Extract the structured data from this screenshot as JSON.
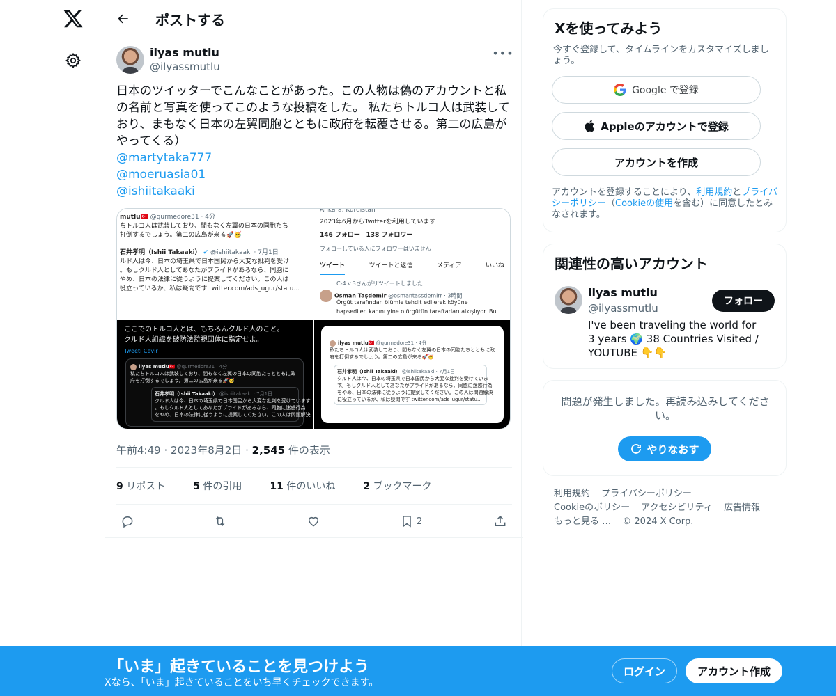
{
  "header": {
    "title": "ポストする"
  },
  "tweet": {
    "author_name": "ilyas mutlu",
    "author_handle": "@ilyassmutlu",
    "more_label": "•••",
    "text": "日本のツイッターでこんなことがあった。この人物は偽のアカウントと私の名前と写真を使ってこのような投稿をした。 私たちトルコ人は武装しており、まもなく日本の左翼同胞とともに政府を転覆させる。第二の広島がやってくる）",
    "mentions": [
      "@martytaka777",
      "@moeruasia01",
      "@ishiitakaaki"
    ],
    "time": "午前4:49",
    "date": "2023年8月2日",
    "views_count": "2,545",
    "views_label": " 件の表示",
    "sep": "·"
  },
  "media": {
    "img1": {
      "line1_name": "mutlu🇹🇷",
      "line1_handle": " @qurmedore31 · 4分",
      "line2": "ちトルコ人は武装しており、間もなく左翼の日本の同胞たち",
      "line3": "打倒するでしょう。第二の広島が来る🚀🥳",
      "line4_name": "石井孝明（Ishii Takaaki）",
      "line4_handle": " @ishiitakaaki · 7月1日",
      "line5": "ルド人は今、日本の埼玉県で日本国民から大変な批判を受け",
      "line6": "。もしクルド人としてあなたがプライドがあるなら、同胞に",
      "line7": "やめ、日本の法律に従うように提案してください。この人は",
      "line8": "役立っているか、私は疑問です twitter.com/ads_ugur/statu..."
    },
    "img2": {
      "location": "Ankara, Kurdistan",
      "joined": "2023年6月からTwitterを利用しています",
      "following": "146 フォロー",
      "followers": "138 フォロワー",
      "no_followers": "フォローしている人にフォロワーはいません",
      "tabs": [
        "ツイート",
        "ツイートと返信",
        "メディア",
        "いいね"
      ],
      "retweet": "C-4 v.3さんがリツイートしました",
      "rt_name": "Osman Taşdemir",
      "rt_handle": " @osmantassdemirr · 3時間",
      "rt_line1": "Örgüt tarafından ölümle tehdit edilerek köyüne",
      "rt_line2": "hapsedilen kadını yine o örgütün taraftarları alkışlıyor. Bu"
    },
    "img3": {
      "line1": "ここでのトルコ人とは、もちろんクルド人のこと。",
      "line2": "クルド人組織を破防法監視団体に指定せよ。",
      "translate": "Tweeti Çevir",
      "card_name": "ilyas mutlu🇹🇷",
      "card_handle": " @qurmedore31 · 4分",
      "card_line1": "私たちトルコ人は武装しており、間もなく左翼の日本の同胞たちとともに政",
      "card_line2": "府を打倒するでしょう。第二の広島が来る🚀🥳",
      "quote_name": "石井孝明（Ishii Takaaki）",
      "quote_handle": " @ishiitakaaki · 7月1日",
      "quote_line1": "クルド人は今、日本の埼玉県で日本国民から大変な批判を受けています",
      "quote_line2": "。もしクルド人としてあなたがプライドがあるなら、同胞に迷惑行為",
      "quote_line3": "をやめ、日本の法律に従うように提案してください。この人は問題解決",
      "quote_line4": "に役立っているか、私は疑問です twitter.com/ads_ugur/statu..."
    },
    "img4": {
      "card_name": "ilyas mutlu🇹🇷",
      "card_handle": " @qurmedore31 · 4分",
      "card_line1": "私たちトルコ人は武装しており、間もなく左翼の日本の同胞たちとともに政",
      "card_line2": "府を打倒するでしょう。第二の広島が来る🚀🥳",
      "quote_name": "石井孝明（Ishii Takaaki）",
      "quote_handle": " @ishiitakaaki · 7月1日",
      "quote_line1": "クルド人は今、日本の埼玉県で日本国民から大変な批判を受けていま",
      "quote_line2": "す。もしクルド人としてあなたがプライドがあるなら、同胞に迷惑行為",
      "quote_line3": "をやめ、日本の法律に従うように提案してください。この人は問題解決",
      "quote_line4": "に役立っているか、私は疑問です twitter.com/ads_ugur/statu..."
    }
  },
  "stats": {
    "reposts_count": "9",
    "reposts_label": " リポスト",
    "quotes_count": "5",
    "quotes_label": " 件の引用",
    "likes_count": "11",
    "likes_label": " 件のいいね",
    "bookmarks_count": "2",
    "bookmarks_label": " ブックマーク"
  },
  "actions": {
    "bookmark_count": "2"
  },
  "signup": {
    "title": "Xを使ってみよう",
    "subtitle": "今すぐ登録して、タイムラインをカスタマイズしましょう。",
    "google_label": "Google で登録",
    "apple_label": "Appleのアカウントで登録",
    "create_label": "アカウントを作成",
    "terms_prefix": "アカウントを登録することにより、",
    "terms_link": "利用規約",
    "terms_and": "と",
    "privacy_link": "プライバシーポリシー",
    "terms_mid": "（",
    "cookie_link": "Cookieの使用",
    "terms_suffix": "を含む）に同意したとみなされます。"
  },
  "related": {
    "title": "関連性の高いアカウント",
    "name": "ilyas mutlu",
    "handle": "@ilyassmutlu",
    "follow_label": "フォロー",
    "bio": "I've been traveling the world for 3 years 🌍 38 Countries Visited / YOUTUBE 👇👇"
  },
  "error": {
    "text": "問題が発生しました。再読み込みしてください。",
    "retry_label": "やりなおす"
  },
  "footer": {
    "links": [
      "利用規約",
      "プライバシーポリシー",
      "Cookieのポリシー",
      "アクセシビリティ",
      "広告情報",
      "もっと見る …",
      "© 2024 X Corp."
    ]
  },
  "bottombar": {
    "title": "「いま」起きていることを見つけよう",
    "subtitle": "Xなら、「いま」起きていることをいち早くチェックできます。",
    "login_label": "ログイン",
    "signup_label": "アカウント作成"
  },
  "colors": {
    "accent": "#1d9bf0",
    "text": "#0f1419",
    "muted": "#536471",
    "border": "#eff3f4"
  }
}
